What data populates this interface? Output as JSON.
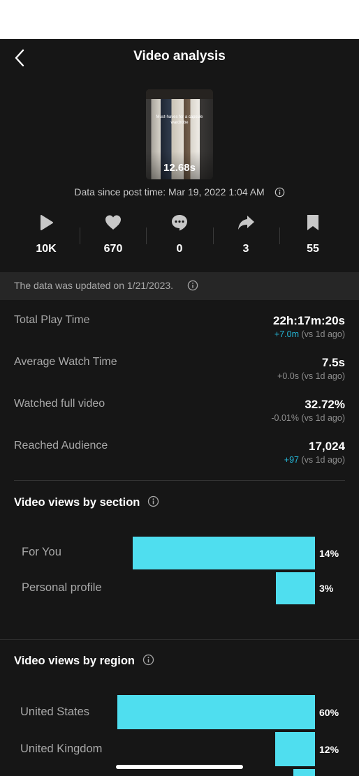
{
  "header": {
    "title": "Video analysis"
  },
  "video": {
    "caption": "Must-haves for a capsule wardrobe",
    "duration": "12.68s",
    "since": "Data since post time: Mar 19, 2022 1:04 AM"
  },
  "stats": [
    {
      "icon": "play-icon",
      "value": "10K"
    },
    {
      "icon": "heart-icon",
      "value": "670"
    },
    {
      "icon": "comment-icon",
      "value": "0"
    },
    {
      "icon": "share-icon",
      "value": "3"
    },
    {
      "icon": "bookmark-icon",
      "value": "55"
    }
  ],
  "update_notice": "The data was updated on 1/21/2023.",
  "metrics": [
    {
      "label": "Total Play Time",
      "value": "22h:17m:20s",
      "delta": "+7.0m",
      "suffix": "(vs 1d ago)"
    },
    {
      "label": "Average Watch Time",
      "value": "7.5s",
      "delta": "+0.0s",
      "suffix": "(vs 1d ago)"
    },
    {
      "label": "Watched full video",
      "value": "32.72%",
      "delta": "-0.01%",
      "suffix": "(vs 1d ago)"
    },
    {
      "label": "Reached Audience",
      "value": "17,024",
      "delta": "+97",
      "suffix": "(vs 1d ago)"
    }
  ],
  "sections": {
    "by_section": {
      "title": "Video views by section",
      "rows": [
        {
          "label": "For You",
          "pct": "14%",
          "share": 14
        },
        {
          "label": "Personal profile",
          "pct": "3%",
          "share": 3
        }
      ]
    },
    "by_region": {
      "title": "Video views by region",
      "rows": [
        {
          "label": "United States",
          "pct": "60%",
          "share": 60
        },
        {
          "label": "United Kingdom",
          "pct": "12%",
          "share": 12
        }
      ]
    }
  },
  "colors": {
    "accent": "#4fdeef",
    "positive": "#25b7d8",
    "background": "#161616"
  }
}
